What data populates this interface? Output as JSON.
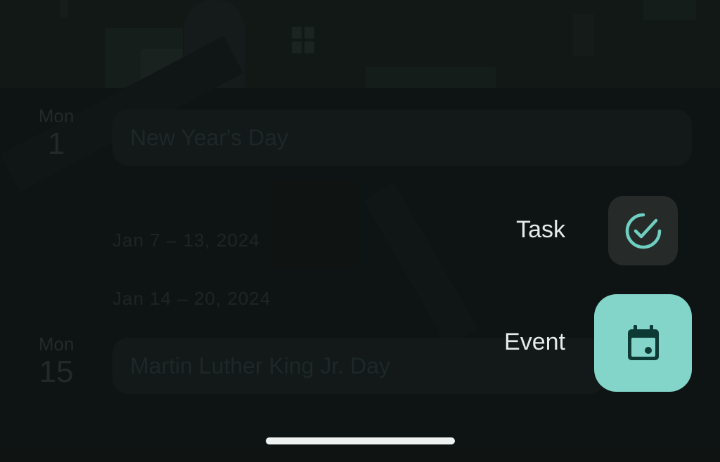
{
  "background": {
    "days": [
      {
        "weekday": "Mon",
        "date": "1",
        "event": "New Year's Day"
      },
      {
        "weekday": "Mon",
        "date": "15",
        "event": "Martin Luther King Jr. Day"
      }
    ],
    "week_ranges": [
      "Jan 7 – 13, 2024",
      "Jan 14 – 20, 2024"
    ]
  },
  "fab_menu": {
    "task_label": "Task",
    "event_label": "Event",
    "task_icon": "task-check-icon",
    "event_icon": "calendar-event-icon"
  },
  "colors": {
    "accent": "#82d5c8",
    "task_fab_bg": "#262b2a",
    "icon_accent": "#6fcfc0",
    "icon_dark": "#0e3a36"
  }
}
